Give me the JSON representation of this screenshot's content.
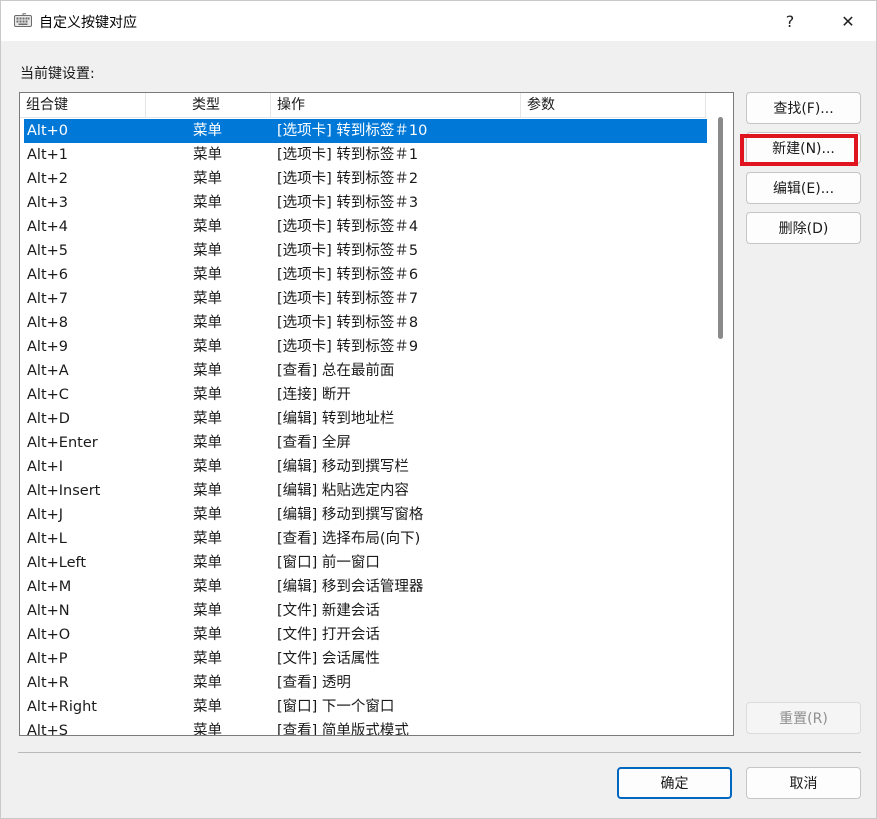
{
  "window": {
    "title": "自定义按键对应",
    "help_label": "?",
    "close_label": "✕",
    "icon": "keyboard-icon"
  },
  "section_label": "当前键设置:",
  "columns": [
    "组合键",
    "类型",
    "操作",
    "参数"
  ],
  "rows": [
    {
      "key": "Alt+0",
      "type": "菜单",
      "action": "[选项卡] 转到标签＃10"
    },
    {
      "key": "Alt+1",
      "type": "菜单",
      "action": "[选项卡] 转到标签＃1"
    },
    {
      "key": "Alt+2",
      "type": "菜单",
      "action": "[选项卡] 转到标签＃2"
    },
    {
      "key": "Alt+3",
      "type": "菜单",
      "action": "[选项卡] 转到标签＃3"
    },
    {
      "key": "Alt+4",
      "type": "菜单",
      "action": "[选项卡] 转到标签＃4"
    },
    {
      "key": "Alt+5",
      "type": "菜单",
      "action": "[选项卡] 转到标签＃5"
    },
    {
      "key": "Alt+6",
      "type": "菜单",
      "action": "[选项卡] 转到标签＃6"
    },
    {
      "key": "Alt+7",
      "type": "菜单",
      "action": "[选项卡] 转到标签＃7"
    },
    {
      "key": "Alt+8",
      "type": "菜单",
      "action": "[选项卡] 转到标签＃8"
    },
    {
      "key": "Alt+9",
      "type": "菜单",
      "action": "[选项卡] 转到标签＃9"
    },
    {
      "key": "Alt+A",
      "type": "菜单",
      "action": "[查看] 总在最前面"
    },
    {
      "key": "Alt+C",
      "type": "菜单",
      "action": "[连接] 断开"
    },
    {
      "key": "Alt+D",
      "type": "菜单",
      "action": "[编辑] 转到地址栏"
    },
    {
      "key": "Alt+Enter",
      "type": "菜单",
      "action": "[查看] 全屏"
    },
    {
      "key": "Alt+I",
      "type": "菜单",
      "action": "[编辑] 移动到撰写栏"
    },
    {
      "key": "Alt+Insert",
      "type": "菜单",
      "action": "[编辑] 粘贴选定内容"
    },
    {
      "key": "Alt+J",
      "type": "菜单",
      "action": "[编辑] 移动到撰写窗格"
    },
    {
      "key": "Alt+L",
      "type": "菜单",
      "action": "[查看] 选择布局(向下)"
    },
    {
      "key": "Alt+Left",
      "type": "菜单",
      "action": "[窗口] 前一窗口"
    },
    {
      "key": "Alt+M",
      "type": "菜单",
      "action": "[编辑] 移到会话管理器"
    },
    {
      "key": "Alt+N",
      "type": "菜单",
      "action": "[文件] 新建会话"
    },
    {
      "key": "Alt+O",
      "type": "菜单",
      "action": "[文件] 打开会话"
    },
    {
      "key": "Alt+P",
      "type": "菜单",
      "action": "[文件] 会话属性"
    },
    {
      "key": "Alt+R",
      "type": "菜单",
      "action": "[查看] 透明"
    },
    {
      "key": "Alt+Right",
      "type": "菜单",
      "action": "[窗口] 下一个窗口"
    },
    {
      "key": "Alt+S",
      "type": "菜单",
      "action": "[查看] 简单版式模式"
    }
  ],
  "selected_row": 0,
  "buttons": {
    "find": "查找(F)...",
    "new": "新建(N)...",
    "edit": "编辑(E)...",
    "delete": "删除(D)",
    "reset": "重置(R)",
    "ok": "确定",
    "cancel": "取消"
  },
  "colors": {
    "selection": "#0078d7",
    "highlight_box": "#e0141e",
    "default_button_border": "#0067c0"
  }
}
